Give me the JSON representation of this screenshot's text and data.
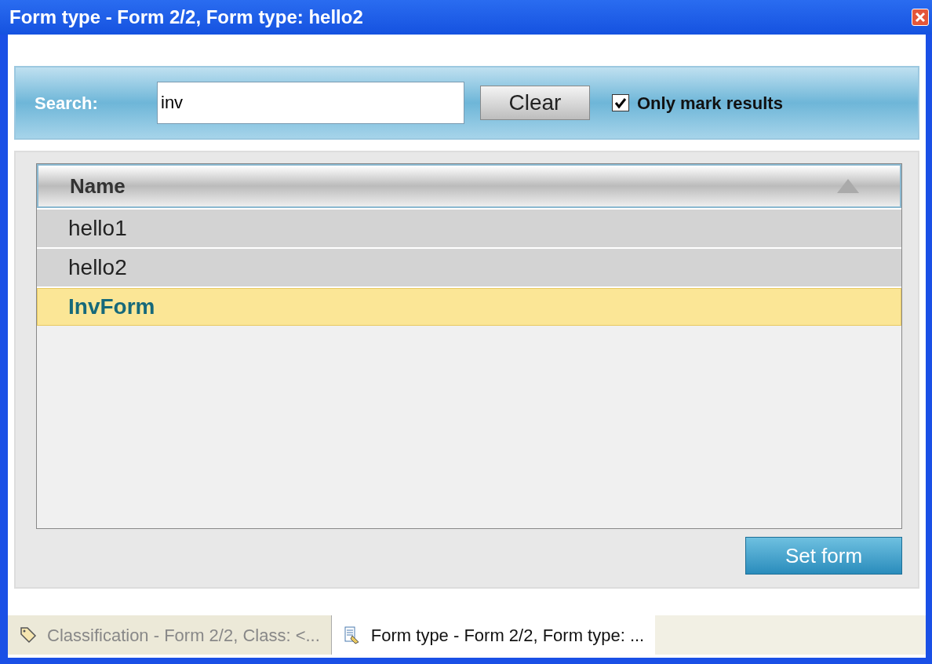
{
  "window": {
    "title": "Form type - Form 2/2, Form type: hello2"
  },
  "search": {
    "label": "Search:",
    "value": "inv",
    "clear_button": "Clear",
    "only_mark": {
      "label": "Only mark results",
      "checked": true
    }
  },
  "list": {
    "column": "Name",
    "rows": [
      {
        "name": "hello1",
        "selected": false,
        "marked": false
      },
      {
        "name": "hello2",
        "selected": false,
        "marked": false
      },
      {
        "name": "InvForm",
        "selected": true,
        "marked": true
      }
    ]
  },
  "set_button": "Set form",
  "tabs": [
    {
      "label": "Classification - Form 2/2, Class: <...",
      "selected": false,
      "kind": "tag"
    },
    {
      "label": "Form type - Form 2/2, Form type: ...",
      "selected": true,
      "kind": "document"
    }
  ]
}
